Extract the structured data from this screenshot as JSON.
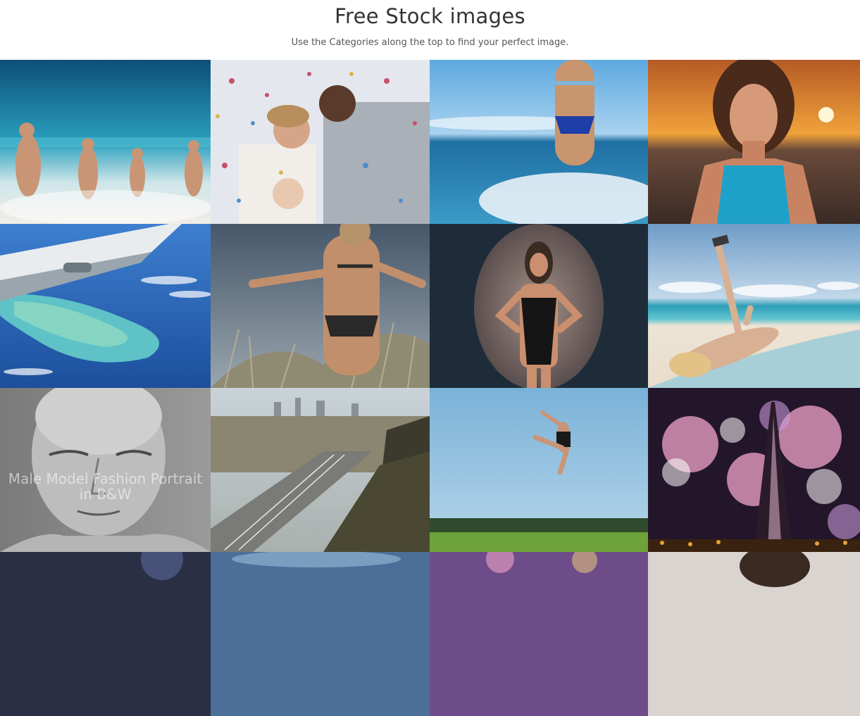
{
  "header": {
    "title": "Free Stock images",
    "subtitle": "Use the Categories along the top to find your perfect image."
  },
  "gallery": {
    "hover_caption": "Male Model Fashion Portrait in B&W",
    "tiles": [
      {
        "subject": "women-running-beach",
        "colors": {
          "sky": "#1c6e9a",
          "sea": "#2a9fbd",
          "sand": "#f2ede6"
        }
      },
      {
        "subject": "wedding-confetti",
        "colors": {
          "bg": "#e4e8ee",
          "accent": "#b6a99a"
        }
      },
      {
        "subject": "woman-splashing-sea",
        "colors": {
          "sky": "#5da9e0",
          "sea": "#1f7fb2",
          "foam": "#f3f7fb"
        }
      },
      {
        "subject": "woman-sunset-portrait",
        "colors": {
          "sky": "#f0a23a",
          "ground": "#3a2a24",
          "top": "#1ea1c9"
        }
      },
      {
        "subject": "airplane-wing-island",
        "colors": {
          "sky": "#2f62b4",
          "island": "#5ec2c6",
          "wing": "#e8ecef"
        }
      },
      {
        "subject": "woman-dune-grass",
        "colors": {
          "sky": "#6a7d90",
          "grass": "#8f8a72"
        }
      },
      {
        "subject": "studio-swimsuit-model",
        "colors": {
          "bg": "#1e2c3a",
          "spot": "#7e6e6a"
        }
      },
      {
        "subject": "woman-selfie-beach",
        "colors": {
          "sky": "#8fb3d6",
          "sea": "#3eb2c6",
          "sand": "#ede4d6"
        }
      },
      {
        "subject": "male-model-bw",
        "colors": {
          "bg": "#8b8b8b",
          "face": "#bdbdbd"
        }
      },
      {
        "subject": "los-angeles-freeway",
        "colors": {
          "sky": "#c9d3d8",
          "hill": "#3b3a2c",
          "road": "#7a7a76"
        }
      },
      {
        "subject": "dancer-jumping-sky",
        "colors": {
          "sky": "#86bde0",
          "field": "#4e7d2a"
        }
      },
      {
        "subject": "eiffel-tower-fireworks",
        "colors": {
          "sky": "#24162a",
          "fireworks": "#f0a4c8"
        }
      },
      {
        "subject": "partial-tile-1",
        "colors": {
          "bg": "#2a2f45"
        }
      },
      {
        "subject": "partial-tile-2",
        "colors": {
          "bg": "#4c6f9a"
        }
      },
      {
        "subject": "partial-tile-3",
        "colors": {
          "bg": "#6e4c8a"
        }
      },
      {
        "subject": "partial-tile-4",
        "colors": {
          "bg": "#d9d4cf"
        }
      }
    ]
  }
}
